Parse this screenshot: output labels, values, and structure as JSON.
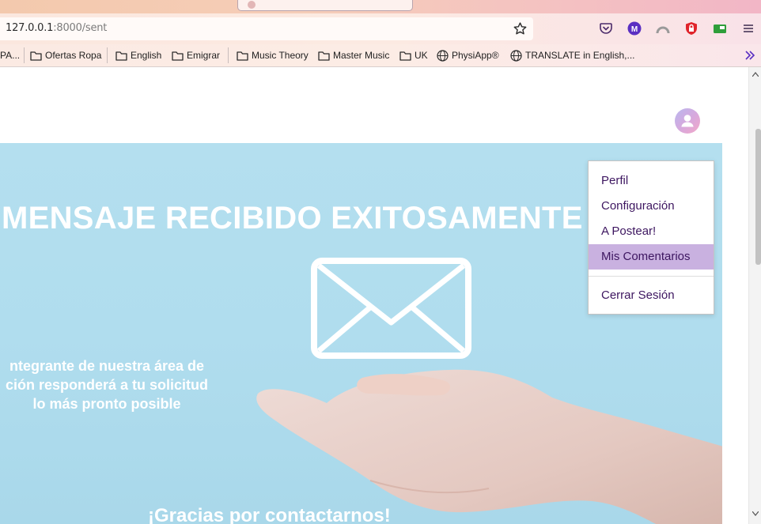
{
  "browser": {
    "url_host": "127.0.0.1",
    "url_path": ":8000/sent",
    "bookmarks": [
      {
        "label": "PA...",
        "icon": "folder-icon"
      },
      {
        "label": "Ofertas Ropa",
        "icon": "folder-icon"
      },
      {
        "label": "English",
        "icon": "folder-icon"
      },
      {
        "label": "Emigrar",
        "icon": "folder-icon"
      },
      {
        "label": "Music Theory",
        "icon": "folder-icon"
      },
      {
        "label": "Master Music",
        "icon": "folder-icon"
      },
      {
        "label": "UK",
        "icon": "folder-icon"
      },
      {
        "label": "PhysiApp®",
        "icon": "globe-icon"
      },
      {
        "label": "TRANSLATE in English,...",
        "icon": "globe-icon"
      }
    ],
    "extensions": [
      "pocket-icon",
      "m-extension-icon",
      "profile-arc-icon",
      "shield-lock-icon",
      "green-extension-icon",
      "menu-icon"
    ]
  },
  "page": {
    "hero_title": "MENSAJE RECIBIDO EXITOSAMENTE",
    "hero_text_line1": "ntegrante de nuestra área de",
    "hero_text_line2": "ción responderá a tu solicitud",
    "hero_text_line3": "lo más pronto posible",
    "thanks": "¡Gracias por contactarnos!",
    "hero_color": "#b0ddee"
  },
  "user_menu": {
    "items": [
      {
        "label": "Perfil"
      },
      {
        "label": "Configuración"
      },
      {
        "label": "A Postear!"
      },
      {
        "label": "Mis Comentarios",
        "active": true
      },
      {
        "label": "Cerrar Sesión"
      }
    ],
    "accent_color": "#c9b1e0",
    "text_color": "#3d1660"
  }
}
